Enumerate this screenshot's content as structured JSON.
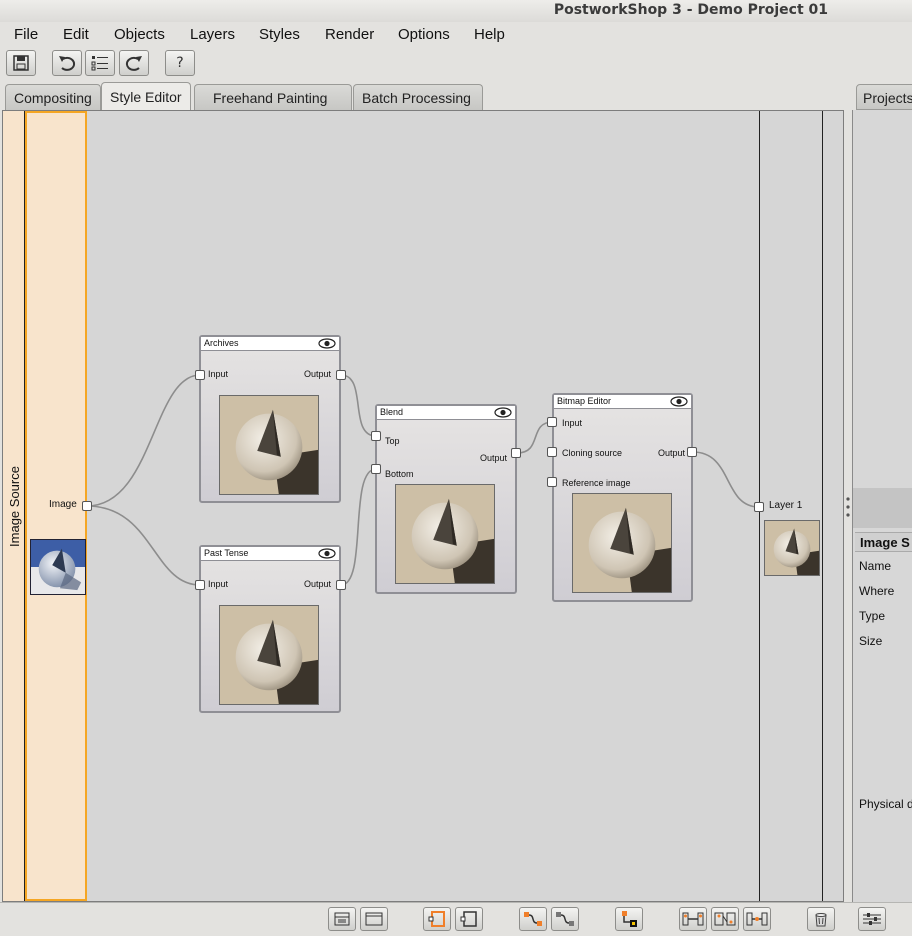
{
  "window": {
    "title": "PostworkShop 3 - Demo Project 01"
  },
  "menu": [
    "File",
    "Edit",
    "Objects",
    "Layers",
    "Styles",
    "Render",
    "Options",
    "Help"
  ],
  "toolbar": {
    "buttons": [
      {
        "icon": "save-icon"
      },
      {
        "icon": "undo-icon"
      },
      {
        "icon": "list-icon"
      },
      {
        "icon": "redo-icon"
      },
      {
        "icon": "help-icon",
        "label": "?"
      }
    ]
  },
  "tabs": [
    {
      "label": "Compositing",
      "active": false
    },
    {
      "label": "Style Editor",
      "active": true
    },
    {
      "label": "Freehand Painting",
      "active": false
    },
    {
      "label": "Batch Processing",
      "active": false
    }
  ],
  "right_tab": "Projects",
  "source": {
    "strip_label": "Image Source",
    "port_label": "Image"
  },
  "nodes": {
    "archives": {
      "title": "Archives",
      "input": "Input",
      "output": "Output"
    },
    "past_tense": {
      "title": "Past Tense",
      "input": "Input",
      "output": "Output"
    },
    "blend": {
      "title": "Blend",
      "top": "Top",
      "bottom": "Bottom",
      "output": "Output"
    },
    "bitmap_editor": {
      "title": "Bitmap Editor",
      "input": "Input",
      "cloning": "Cloning source",
      "reference": "Reference image",
      "output": "Output"
    }
  },
  "layer": {
    "label": "Layer 1"
  },
  "properties": {
    "header": "Image S",
    "rows": [
      "Name",
      "Where",
      "Type",
      "Size",
      "Physical d"
    ]
  },
  "colors": {
    "source_strip": "#f8e4cc",
    "source_selected_border": "#f5a623",
    "canvas": "#d6d6d6",
    "accent_orange": "#f07f2a"
  }
}
